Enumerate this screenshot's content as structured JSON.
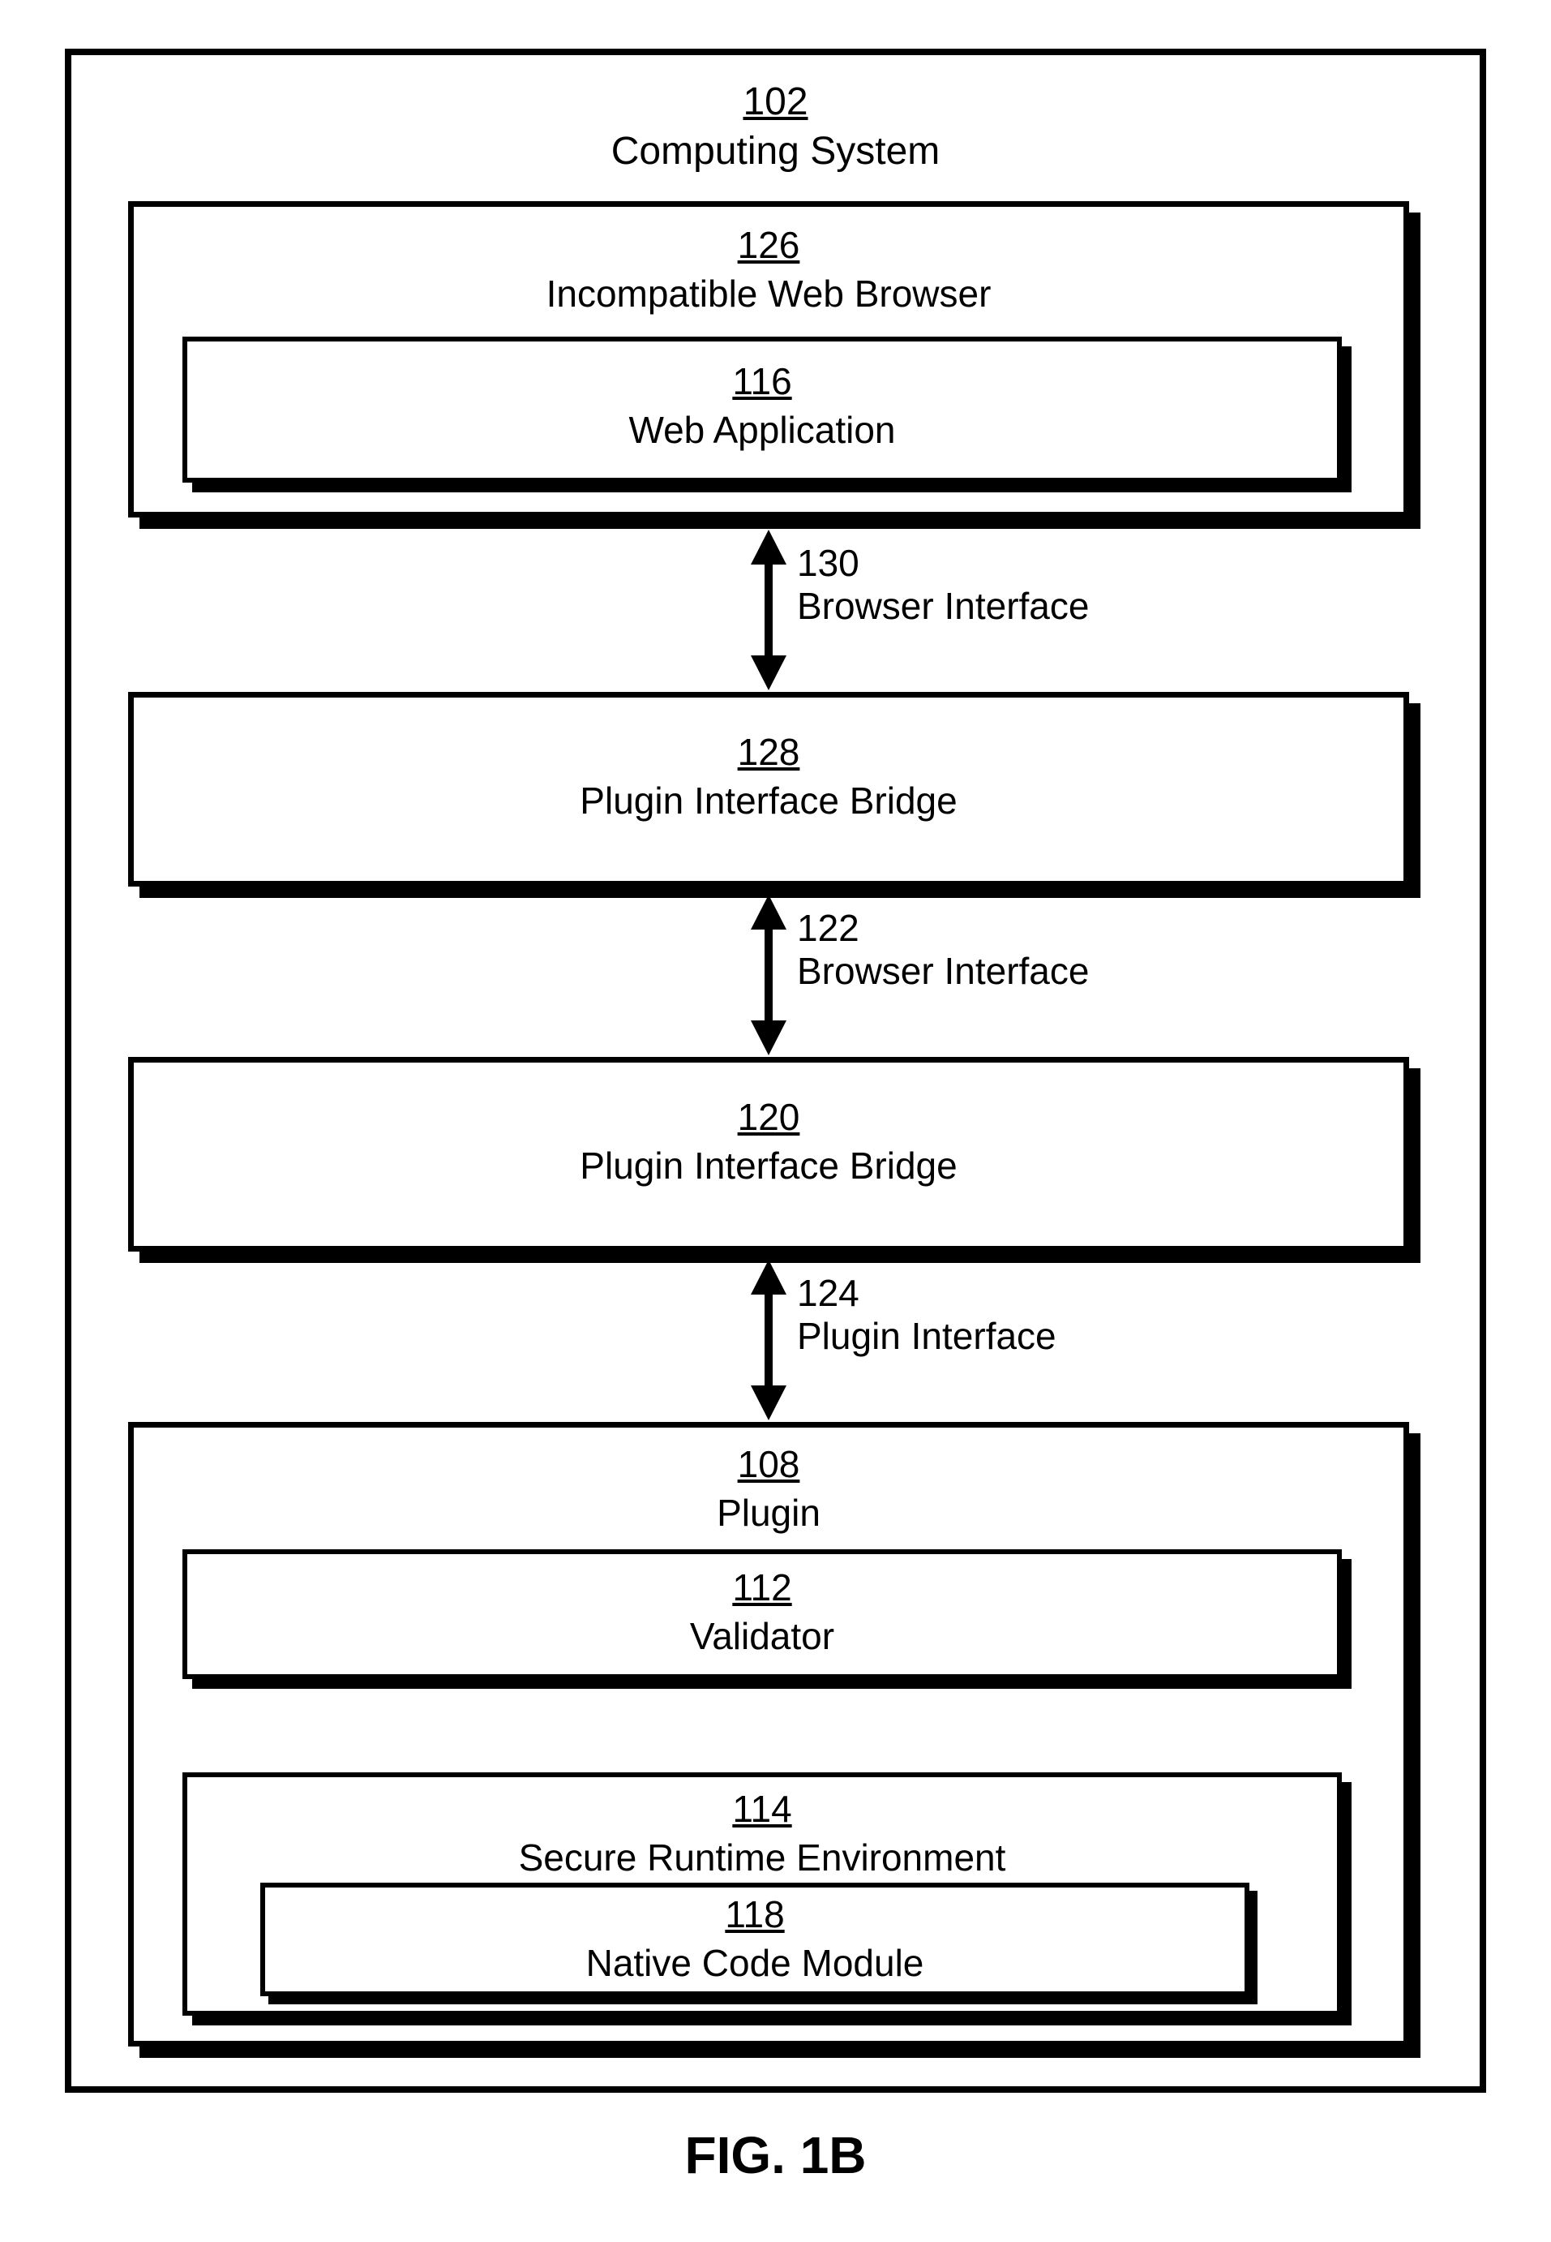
{
  "system": {
    "num": "102",
    "label": "Computing System"
  },
  "browser": {
    "num": "126",
    "label": "Incompatible Web Browser"
  },
  "webapp": {
    "num": "116",
    "label": "Web Application"
  },
  "if130": {
    "num": "130",
    "label": "Browser Interface"
  },
  "bridge1": {
    "num": "128",
    "label": "Plugin Interface Bridge"
  },
  "if122": {
    "num": "122",
    "label": "Browser Interface"
  },
  "bridge2": {
    "num": "120",
    "label": "Plugin Interface Bridge"
  },
  "if124": {
    "num": "124",
    "label": "Plugin Interface"
  },
  "plugin": {
    "num": "108",
    "label": "Plugin"
  },
  "validator": {
    "num": "112",
    "label": "Validator"
  },
  "sre": {
    "num": "114",
    "label": "Secure Runtime Environment"
  },
  "ncm": {
    "num": "118",
    "label": "Native Code Module"
  },
  "figure": "FIG. 1B"
}
